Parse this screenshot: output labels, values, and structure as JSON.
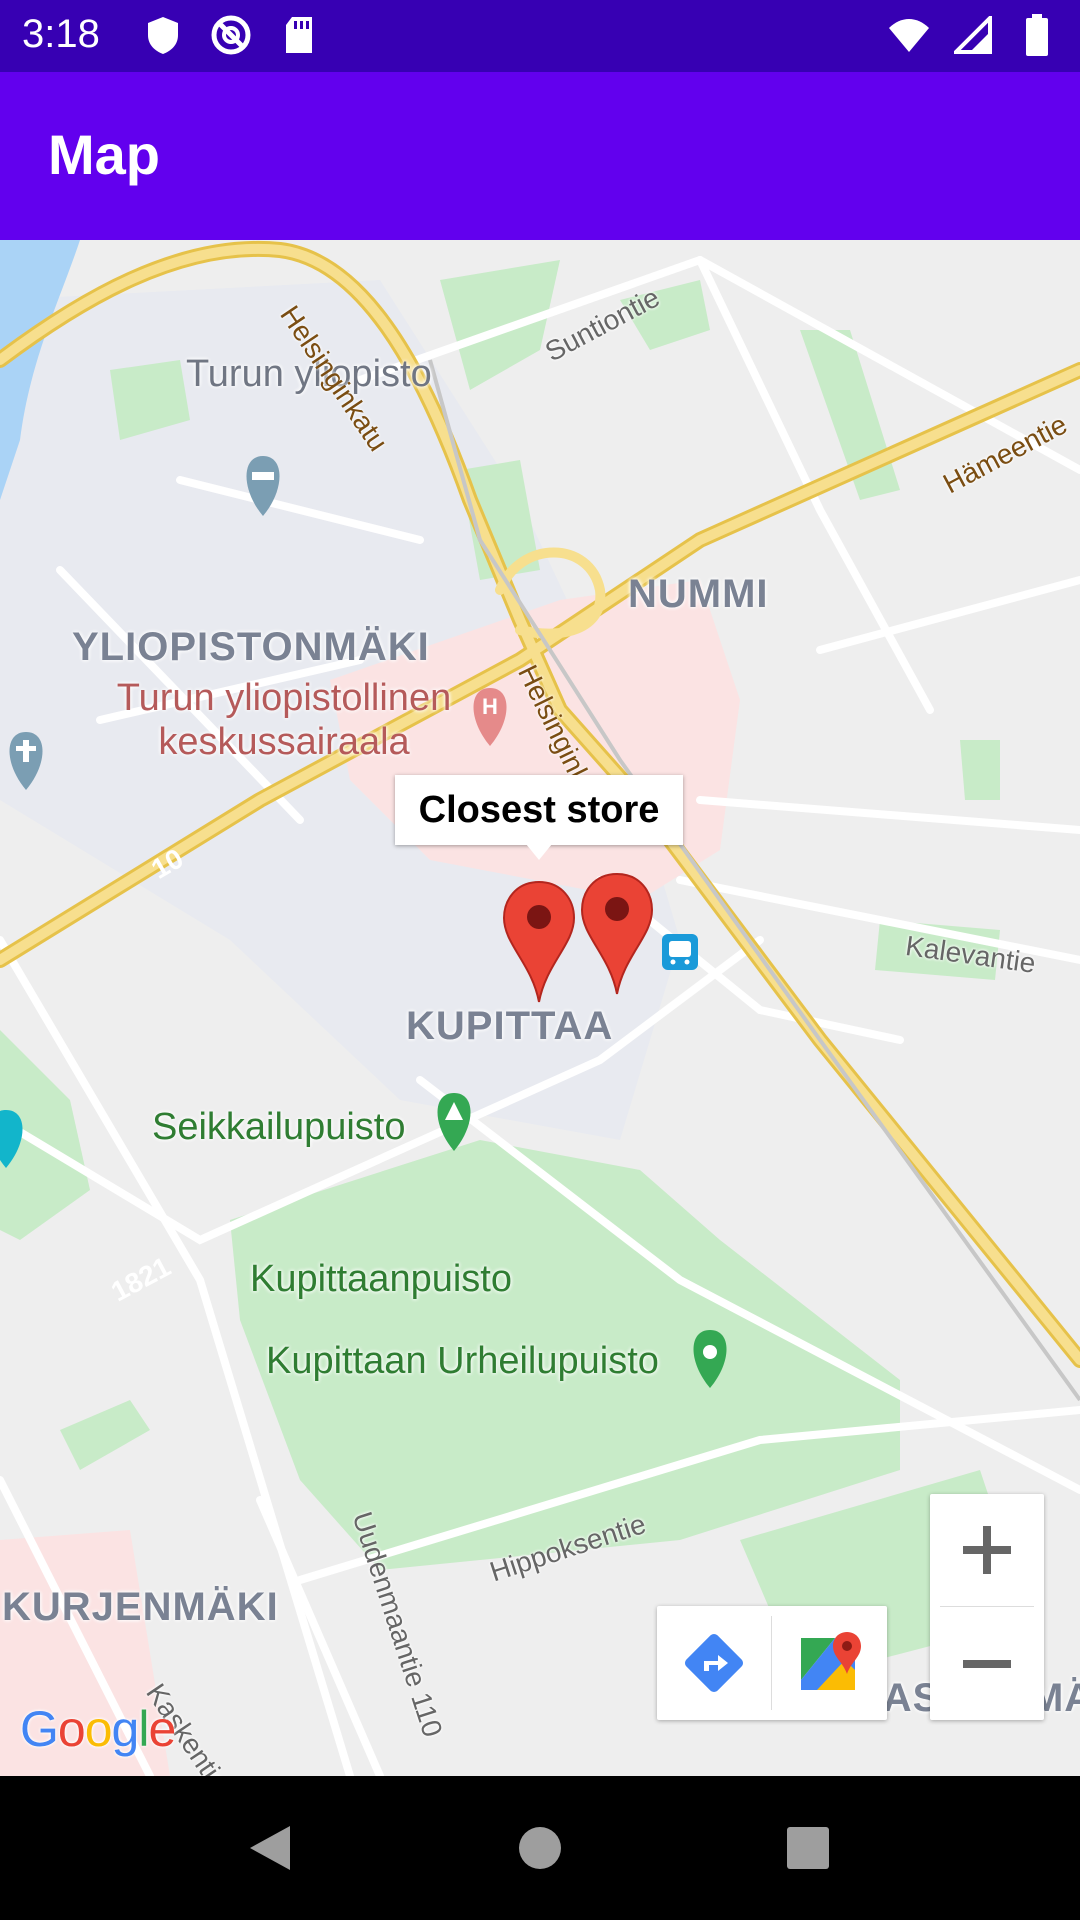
{
  "status_bar": {
    "time": "3:18",
    "left_icons": [
      "shield-icon",
      "no-tracking-icon",
      "sd-card-icon"
    ],
    "right_icons": [
      "wifi-icon",
      "signal-icon",
      "battery-icon"
    ]
  },
  "app_bar": {
    "title": "Map"
  },
  "map": {
    "districts": [
      "NUMMI",
      "YLIOPISTONMÄKI",
      "KUPITTAA",
      "KURJENMÄKI",
      "VASARAMÄ"
    ],
    "places": {
      "university": "Turun yliopisto",
      "hospital": "Turun yliopistollinen keskussairaala",
      "park1": "Seikkailupuisto",
      "park2": "Kupittaanpuisto",
      "sports": "Kupittaan Urheilupuisto"
    },
    "streets": {
      "helsinginkatu_north": "Helsinginkatu",
      "helsinginkatu_south": "Helsinginkatu",
      "suntiontie": "Suntiontie",
      "hameentie": "Hämeentie",
      "kalevantie": "Kalevantie",
      "hippoksentie": "Hippoksentie",
      "uudenmaantie": "Uudenmaantie 110",
      "kaskentie": "Kaskentie",
      "route10": "10",
      "route1821": "1821"
    },
    "info_window": {
      "text": "Closest store"
    },
    "markers": [
      {
        "name": "store-marker-1"
      },
      {
        "name": "store-marker-2"
      }
    ],
    "attribution": "Google",
    "zoom_in_label": "+",
    "zoom_out_label": "−"
  },
  "nav_bar": {
    "buttons": [
      "back-icon",
      "home-icon",
      "recents-icon"
    ]
  },
  "colors": {
    "status_bar": "#3700b3",
    "app_bar": "#6200ee",
    "marker": "#ea4335",
    "park": "#c8ebc8",
    "highway": "#f7d66b"
  }
}
